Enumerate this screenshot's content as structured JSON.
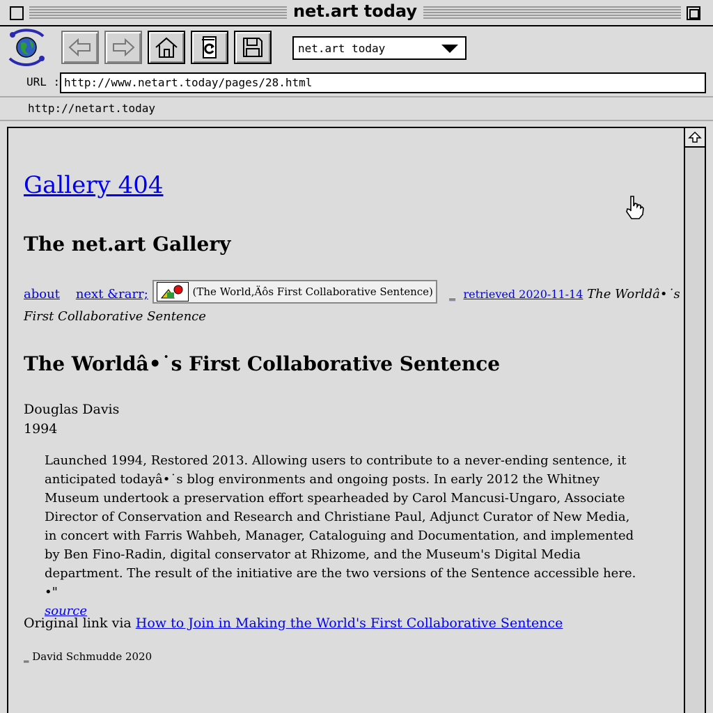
{
  "window": {
    "title": "net.art today"
  },
  "toolbar": {
    "buttons": [
      {
        "name": "back-arrow-icon",
        "enabled": false
      },
      {
        "name": "forward-arrow-icon",
        "enabled": false
      },
      {
        "name": "home-icon",
        "enabled": true
      },
      {
        "name": "reload-icon",
        "enabled": true
      },
      {
        "name": "save-icon",
        "enabled": true
      }
    ],
    "page_select": "net.art today"
  },
  "url_bar": {
    "label": "URL :",
    "value": "http://www.netart.today/pages/28.html"
  },
  "status": {
    "text": "http://netart.today"
  },
  "page": {
    "gallery_link": "Gallery 404",
    "gallery_heading": "The net.art Gallery",
    "nav": {
      "about": "about",
      "next": "next &rarr;",
      "image_alt": "(The World,Äôs First Collaborative Sentence)",
      "underscore": "_",
      "retrieved": "retrieved 2020-11-14",
      "italic_title_1": "The Worldâ•˙s",
      "italic_title_2": "First Collaborative Sentence"
    },
    "work_title": "The Worldâ•˙s First Collaborative Sentence",
    "artist": "Douglas Davis",
    "year": "1994",
    "description": "Launched 1994, Restored 2013. Allowing users to contribute to a never-ending sentence, it anticipated todayâ•˙s blog environments and ongoing posts. In early 2012 the Whitney Museum undertook a preservation effort spearheaded by Carol Mancusi-Ungaro, Associate Director of Conservation and Research and Christiane Paul, Adjunct Curator of New Media, in concert with Farris Wahbeh, Manager, Cataloguing and Documentation, and implemented by Ben Fino-Radin, digital conservator at Rhizome, and the Museum's Digital Media department. The result of the initiative are the two versions of the Sentence accessible here.",
    "desc_mark": "•\"",
    "source_link": "source",
    "original_prefix": "Original link via",
    "original_link": "How to Join in Making the World's First Collaborative Sentence",
    "signature_underscore": "_",
    "signature": "David Schmudde 2020"
  }
}
